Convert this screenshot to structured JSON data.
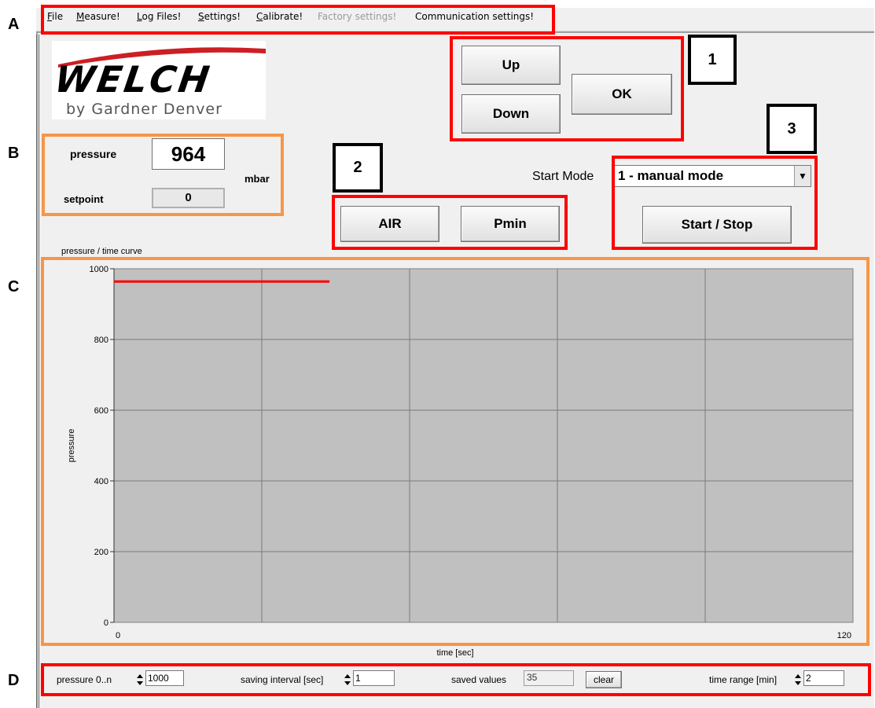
{
  "annotations": {
    "section_labels": [
      "A",
      "B",
      "C",
      "D"
    ],
    "callouts": [
      "1",
      "2",
      "3"
    ]
  },
  "menu": {
    "items": [
      {
        "label": "File",
        "ul": "F",
        "rest": "ile",
        "enabled": true
      },
      {
        "label": "Measure!",
        "ul": "M",
        "rest": "easure!",
        "enabled": true
      },
      {
        "label": "Log Files!",
        "ul": "L",
        "rest": "og Files!",
        "enabled": true
      },
      {
        "label": "Settings!",
        "ul": "S",
        "rest": "ettings!",
        "enabled": true
      },
      {
        "label": "Calibrate!",
        "ul": "C",
        "rest": "alibrate!",
        "enabled": true
      },
      {
        "label": "Factory settings!",
        "ul": "",
        "rest": "Factory settings!",
        "enabled": false
      },
      {
        "label": "Communication settings!",
        "ul": "",
        "rest": "Communication settings!",
        "enabled": true
      }
    ]
  },
  "logo": {
    "brand": "WELCH",
    "tagline": "by Gardner Denver",
    "color": "#cc1f24"
  },
  "readout": {
    "pressure_label": "pressure",
    "pressure_value": "964",
    "unit": "mbar",
    "setpoint_label": "setpoint",
    "setpoint_value": "0"
  },
  "controls": {
    "up": "Up",
    "down": "Down",
    "ok": "OK",
    "air": "AIR",
    "pmin": "Pmin",
    "start_mode_label": "Start Mode",
    "start_mode_value": "1 - manual mode",
    "start_stop": "Start / Stop"
  },
  "chart_data": {
    "type": "line",
    "title": "pressure / time curve",
    "xlabel": "time [sec]",
    "ylabel": "pressure",
    "xlim": [
      0,
      120
    ],
    "ylim": [
      0,
      1000
    ],
    "x_tick_labels": [
      "0",
      "120"
    ],
    "y_tick_labels": [
      "0",
      "200",
      "400",
      "600",
      "800",
      "1000"
    ],
    "grid": true,
    "plot_background": "#c0c0c0",
    "series": [
      {
        "color": "#ff0000",
        "x": [
          0,
          35
        ],
        "y": [
          964,
          964
        ]
      }
    ]
  },
  "footer": {
    "pressure_range_label": "pressure 0..n",
    "pressure_range_value": "1000",
    "saving_interval_label": "saving interval [sec]",
    "saving_interval_value": "1",
    "saved_values_label": "saved values",
    "saved_values_value": "35",
    "clear_label": "clear",
    "time_range_label": "time range [min]",
    "time_range_value": "2"
  },
  "colors": {
    "annotation_red": "#ff0000",
    "annotation_orange": "#f79646",
    "window_bg": "#f0f0f0"
  }
}
